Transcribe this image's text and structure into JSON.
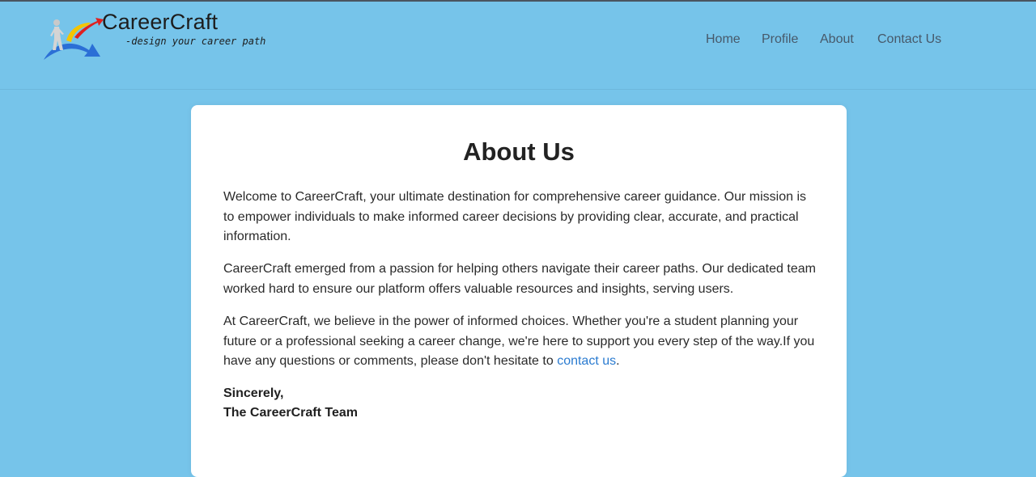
{
  "brand": {
    "name": "CareerCraft",
    "tagline": "-design your career path"
  },
  "nav": {
    "items": [
      "Home",
      "Profile",
      "About",
      "Contact Us"
    ]
  },
  "about": {
    "heading": "About Us",
    "p1": "Welcome to CareerCraft, your ultimate destination for comprehensive career guidance. Our mission is to empower individuals to make informed career decisions by providing clear, accurate, and practical information.",
    "p2": "CareerCraft emerged from a passion for helping others navigate their career paths. Our dedicated team worked hard to ensure our platform offers valuable resources and insights, serving users.",
    "p3_text": "At CareerCraft, we believe in the power of informed choices. Whether you're a student planning your future or a professional seeking a career change, we're here to support you every step of the way.If you have any questions or comments, please don't hesitate to ",
    "p3_link": "contact us",
    "p3_end": ".",
    "sign_1": "Sincerely,",
    "sign_2": "The CareerCraft Team"
  },
  "colors": {
    "page_bg": "#76c4ea",
    "card_bg": "#ffffff",
    "nav_text": "#47596a",
    "link": "#2a7bd0"
  },
  "icons": {
    "logo": "career-path-logo-icon"
  }
}
